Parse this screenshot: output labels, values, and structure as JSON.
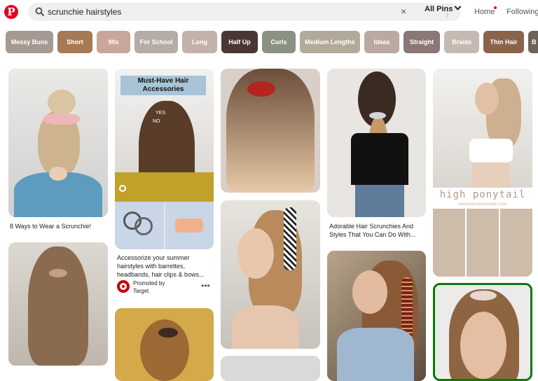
{
  "search": {
    "query": "scrunchie hairstyles",
    "scope": "All Pins"
  },
  "nav": {
    "home": "Home",
    "following": "Following"
  },
  "chips": [
    {
      "label": "Messy Buns",
      "color": "#a59a92"
    },
    {
      "label": "Short",
      "color": "#a57a54"
    },
    {
      "label": "90s",
      "color": "#c8a69b"
    },
    {
      "label": "For School",
      "color": "#b5aba7"
    },
    {
      "label": "Long",
      "color": "#c3b1ab"
    },
    {
      "label": "Half Up",
      "color": "#4a3633"
    },
    {
      "label": "Curls",
      "color": "#899283"
    },
    {
      "label": "Medium Lengths",
      "color": "#b3a99b"
    },
    {
      "label": "Ideas",
      "color": "#b9a9a1"
    },
    {
      "label": "Straight",
      "color": "#8c7676"
    },
    {
      "label": "Braids",
      "color": "#c5bab2"
    },
    {
      "label": "Thin Hair",
      "color": "#8b634b"
    },
    {
      "label": "B",
      "color": "#6f6257"
    }
  ],
  "pins": {
    "p1_caption": "8 Ways to Wear a Scrunchie!",
    "p2_banner": "Must-Have Hair Accessories",
    "p2_text1": "YES",
    "p2_text2": "NO",
    "p2_caption": "Accessorize your summer hairstyles with barrettes, headbands, hair clips & bows...",
    "p2_promoted": "Promoted by",
    "p2_brand": "Target",
    "p4_caption": "Adorable Hair Scrunchies And Styles That You Can Do With...",
    "p5_overlay": "high ponytail",
    "p5_site": "www.lulusimonstudio.com"
  }
}
